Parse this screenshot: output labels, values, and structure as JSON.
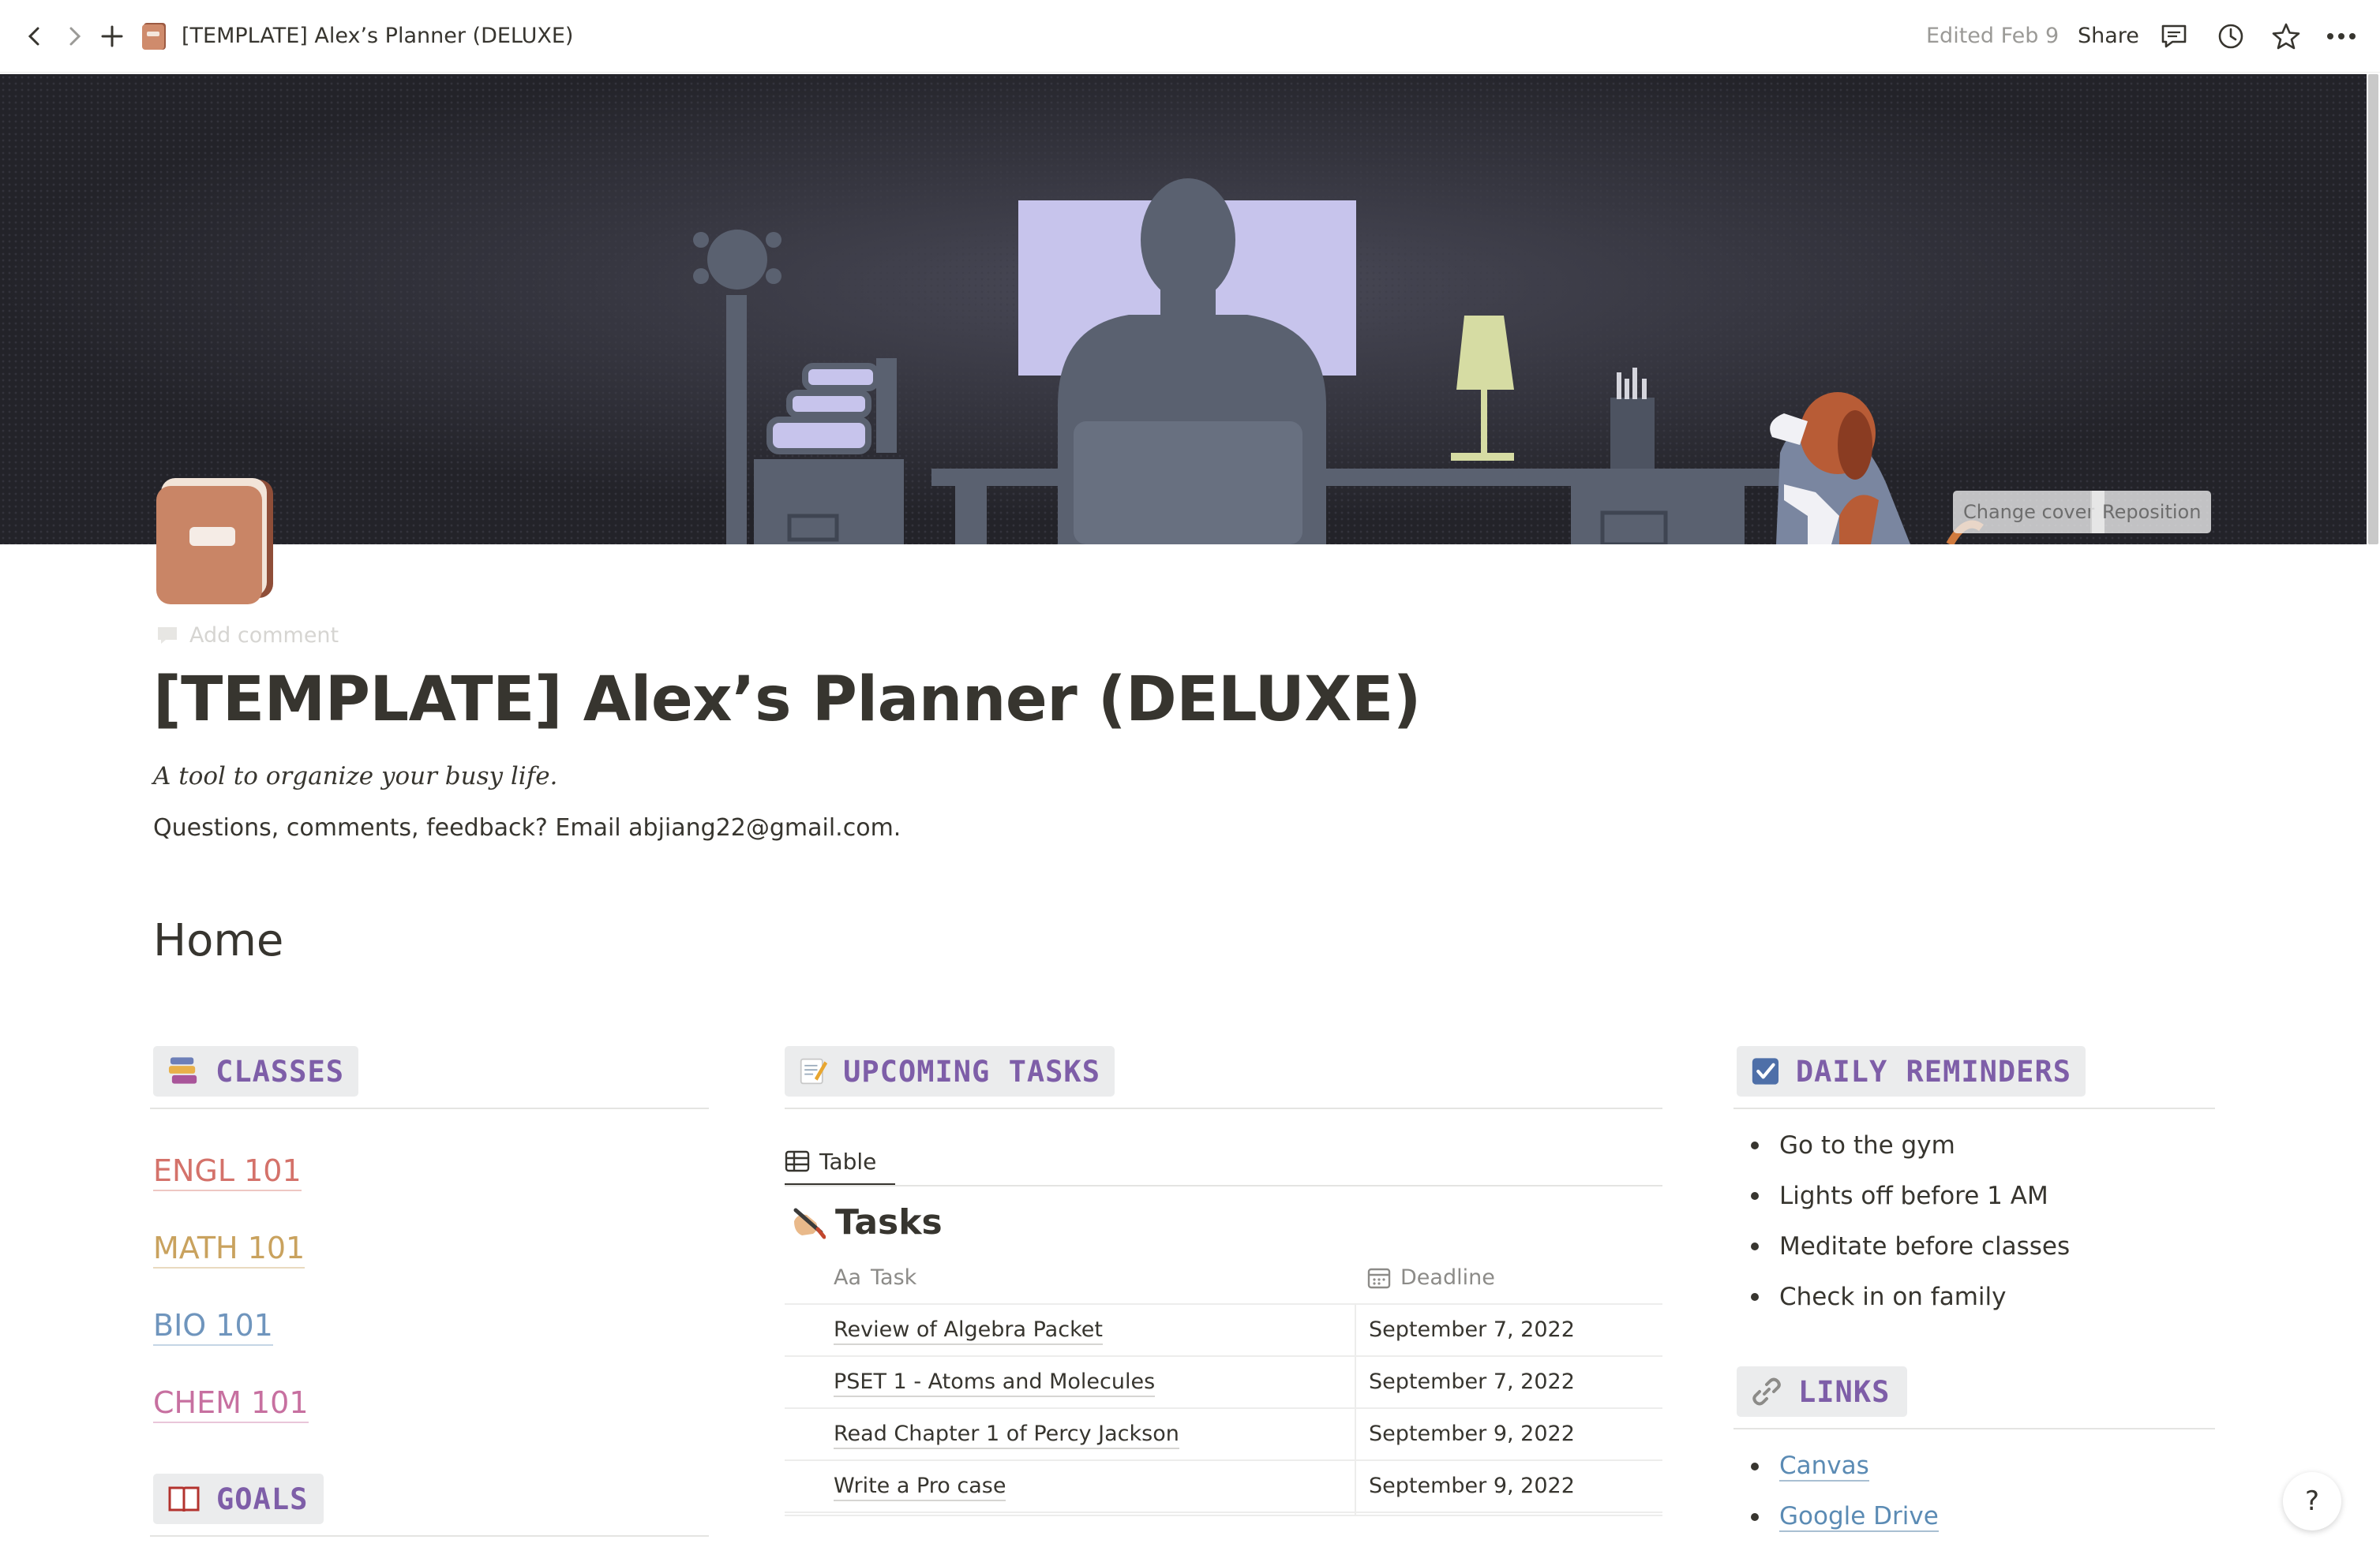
{
  "topbar": {
    "page_title": "[TEMPLATE] Alex’s Planner (DELUXE)",
    "edited": "Edited Feb 9",
    "share": "Share"
  },
  "cover": {
    "change_cover": "Change cover",
    "reposition": "Reposition"
  },
  "page": {
    "add_comment": "Add comment",
    "title": "[TEMPLATE] Alex’s Planner (DELUXE)",
    "subtitle": "A tool to organize your busy life.",
    "contact": "Questions, comments, feedback? Email abjiang22@gmail.com.",
    "home_heading": "Home"
  },
  "classes": {
    "heading": "CLASSES",
    "items": [
      {
        "label": "ENGL 101",
        "color": "#d4726a"
      },
      {
        "label": "MATH 101",
        "color": "#c9a25e"
      },
      {
        "label": "BIO 101",
        "color": "#6f95bd"
      },
      {
        "label": "CHEM 101",
        "color": "#c770a0"
      }
    ]
  },
  "goals": {
    "heading": "GOALS"
  },
  "tasks": {
    "heading": "UPCOMING TASKS",
    "view_tab": "Table",
    "table_title": "Tasks",
    "col_task": "Task",
    "col_task_prefix": "Aa",
    "col_deadline": "Deadline",
    "rows": [
      {
        "task": "Review of Algebra Packet",
        "deadline": "September 7, 2022"
      },
      {
        "task": "PSET 1 - Atoms and Molecules",
        "deadline": "September 7, 2022"
      },
      {
        "task": "Read Chapter 1 of Percy Jackson",
        "deadline": "September 9, 2022"
      },
      {
        "task": "Write a Pro case",
        "deadline": "September 9, 2022"
      }
    ]
  },
  "reminders": {
    "heading": "DAILY REMINDERS",
    "items": [
      "Go to the gym",
      "Lights off before 1 AM",
      "Meditate before classes",
      "Check in on family"
    ]
  },
  "links": {
    "heading": "LINKS",
    "items": [
      "Canvas",
      "Google Drive"
    ]
  },
  "help": "?",
  "colors": {
    "accent_purple": "#7e5ea8",
    "header_bg": "#ebeced",
    "text": "#37352f"
  }
}
